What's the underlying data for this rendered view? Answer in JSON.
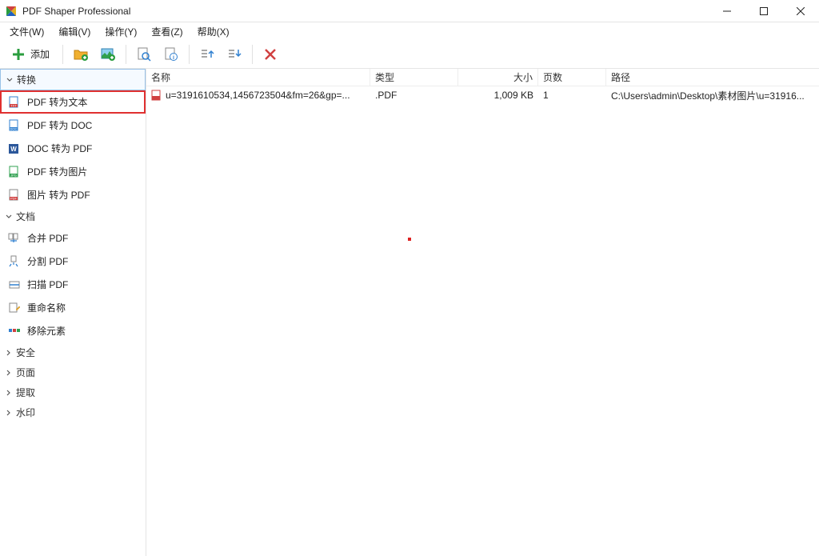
{
  "app": {
    "title": "PDF Shaper Professional"
  },
  "menu": {
    "file": "文件(W)",
    "edit": "编辑(V)",
    "action": "操作(Y)",
    "view": "查看(Z)",
    "help": "帮助(X)"
  },
  "toolbar": {
    "add": "添加"
  },
  "sidebar": {
    "groups": [
      {
        "key": "convert",
        "label": "转换",
        "expanded": true,
        "selected": true,
        "items": [
          {
            "key": "pdf_to_text",
            "label": "PDF 转为文本",
            "highlight": true,
            "icon": "txt"
          },
          {
            "key": "pdf_to_doc",
            "label": "PDF 转为 DOC",
            "icon": "doc"
          },
          {
            "key": "doc_to_pdf",
            "label": "DOC 转为 PDF",
            "icon": "word"
          },
          {
            "key": "pdf_to_image",
            "label": "PDF 转为图片",
            "icon": "jpg"
          },
          {
            "key": "image_to_pdf",
            "label": "图片 转为 PDF",
            "icon": "pdf"
          }
        ]
      },
      {
        "key": "document",
        "label": "文档",
        "expanded": true,
        "items": [
          {
            "key": "merge",
            "label": "合并 PDF",
            "icon": "merge"
          },
          {
            "key": "split",
            "label": "分割 PDF",
            "icon": "split"
          },
          {
            "key": "scan",
            "label": "扫描 PDF",
            "icon": "scan"
          },
          {
            "key": "rename",
            "label": "重命名称",
            "icon": "rename"
          },
          {
            "key": "remove",
            "label": "移除元素",
            "icon": "remove"
          }
        ]
      },
      {
        "key": "security",
        "label": "安全",
        "expanded": false
      },
      {
        "key": "page",
        "label": "页面",
        "expanded": false
      },
      {
        "key": "extract",
        "label": "提取",
        "expanded": false
      },
      {
        "key": "watermark",
        "label": "水印",
        "expanded": false
      }
    ]
  },
  "columns": {
    "name": "名称",
    "type": "类型",
    "size": "大小",
    "pages": "页数",
    "path": "路径"
  },
  "files": [
    {
      "name": "u=3191610534,1456723504&fm=26&gp=...",
      "type": ".PDF",
      "size": "1,009 KB",
      "pages": "1",
      "path": "C:\\Users\\admin\\Desktop\\素材图片\\u=31916..."
    }
  ]
}
